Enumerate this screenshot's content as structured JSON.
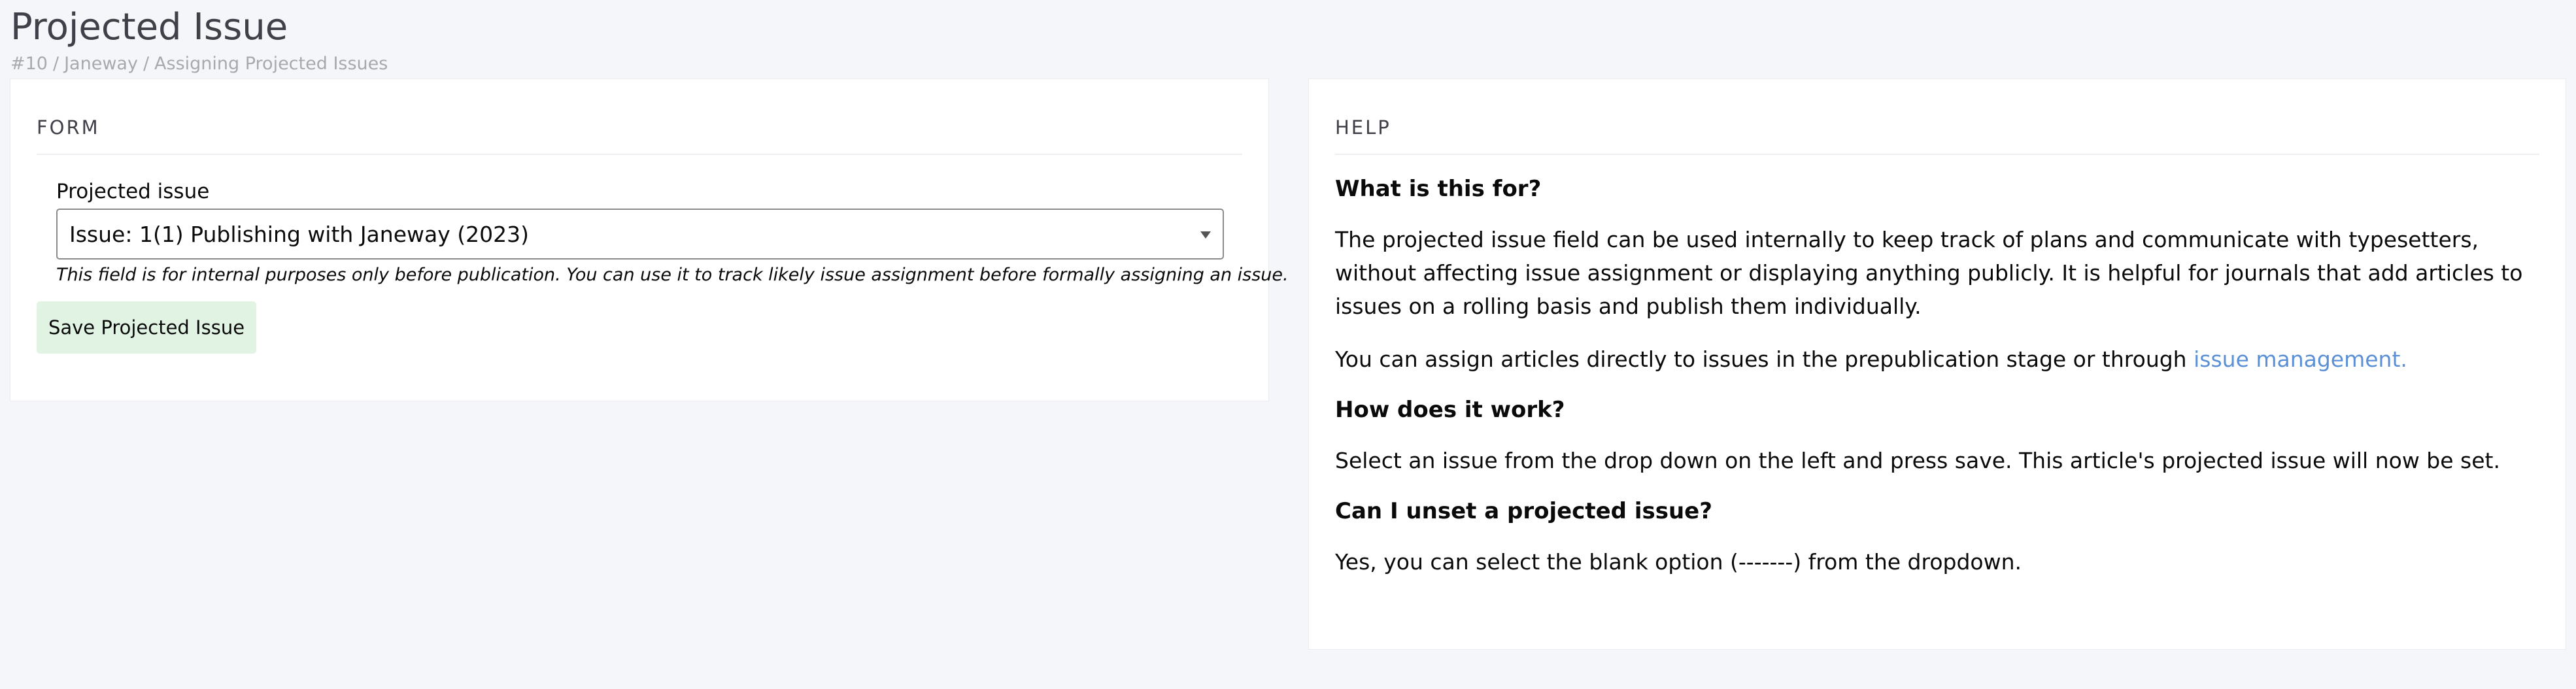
{
  "page": {
    "title": "Projected Issue"
  },
  "breadcrumb": {
    "items": [
      "#10",
      "Janeway",
      "Assigning Projected Issues"
    ],
    "separator": "/"
  },
  "form_card": {
    "heading": "FORM",
    "field_label": "Projected issue",
    "select_value": "Issue: 1(1) Publishing with Janeway (2023)",
    "field_help": "This field is for internal purposes only before publication. You can use it to track likely issue assignment before formally assigning an issue.",
    "save_label": "Save Projected Issue"
  },
  "help_card": {
    "heading": "HELP",
    "q1": "What is this for?",
    "p1": "The projected issue field can be used internally to keep track of plans and communicate with typesetters, without affecting issue assignment or displaying anything publicly. It is helpful for journals that add articles to issues on a rolling basis and publish them individually.",
    "p2_prefix": "You can assign articles directly to issues in the prepublication stage or through ",
    "p2_link": "issue management.",
    "q2": "How does it work?",
    "p3": "Select an issue from the drop down on the left and press save. This article's projected issue will now be set.",
    "q3": "Can I unset a projected issue?",
    "p4": "Yes, you can select the blank option (-------) from the dropdown."
  },
  "colors": {
    "background": "#f5f6fa",
    "card": "#ffffff",
    "save_button": "#e1f4e4",
    "link": "#5b8fd6",
    "breadcrumb": "#a8a9ad"
  },
  "icons": {
    "select_caret": "chevron-down-icon"
  }
}
